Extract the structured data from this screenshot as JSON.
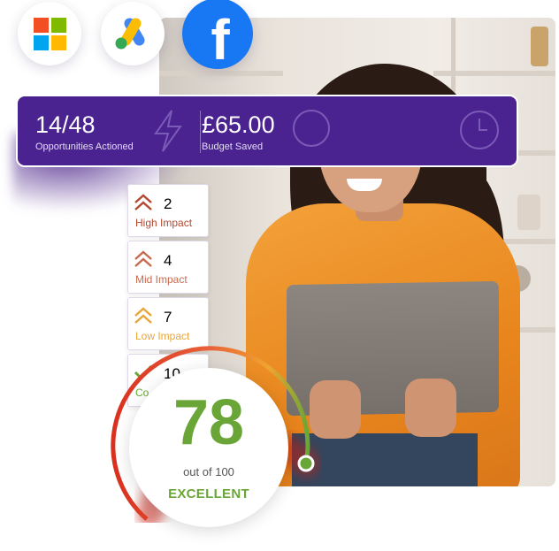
{
  "platforms": [
    {
      "name": "microsoft-logo"
    },
    {
      "name": "google-ads-logo"
    },
    {
      "name": "facebook-logo",
      "glyph": "f"
    }
  ],
  "stats": {
    "opportunities": {
      "value": "14/48",
      "label": "Opportunities Actioned",
      "icon": "lightning-icon"
    },
    "budget": {
      "value": "£65.00",
      "label": "Budget Saved",
      "icon": "pound-icon"
    },
    "time_icon": "clock-icon"
  },
  "impacts": [
    {
      "count": "2",
      "label": "High Impact",
      "color": "#b5472e"
    },
    {
      "count": "4",
      "label": "Mid Impact",
      "color": "#c96a4e"
    },
    {
      "count": "7",
      "label": "Low Impact",
      "color": "#e9a53a"
    },
    {
      "count": "10",
      "label": "Co",
      "color": "#6aa637"
    }
  ],
  "score": {
    "value": "78",
    "out_of": "out of 100",
    "rating": "EXCELLENT",
    "progress": 0.78
  },
  "colors": {
    "banner": "#4a2391",
    "score_green": "#6aa637",
    "gauge_red": "#d9301f"
  }
}
